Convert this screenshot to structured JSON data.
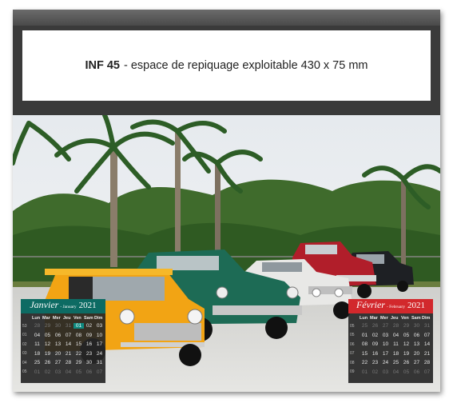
{
  "imprint": {
    "code": "INF 45",
    "text": "- espace de repiquage exploitable 430 x 75 mm"
  },
  "colors": {
    "january_header": "#0d6b63",
    "february_header": "#d2282c",
    "frame": "#3a3a3a"
  },
  "calendar": {
    "weekdays": [
      "Lun",
      "Mar",
      "Mer",
      "Jeu",
      "Ven",
      "Sam",
      "Dim"
    ],
    "january": {
      "name": "Janvier",
      "subtitle": "- January",
      "year": "2021",
      "weeks": [
        {
          "wk": "53",
          "days": [
            "28",
            "29",
            "30",
            "31",
            "01",
            "02",
            "03"
          ],
          "out": [
            true,
            true,
            true,
            true,
            false,
            false,
            false
          ]
        },
        {
          "wk": "01",
          "days": [
            "04",
            "05",
            "06",
            "07",
            "08",
            "09",
            "10"
          ],
          "out": [
            false,
            false,
            false,
            false,
            false,
            false,
            false
          ]
        },
        {
          "wk": "02",
          "days": [
            "11",
            "12",
            "13",
            "14",
            "15",
            "16",
            "17"
          ],
          "out": [
            false,
            false,
            false,
            false,
            false,
            false,
            false
          ]
        },
        {
          "wk": "03",
          "days": [
            "18",
            "19",
            "20",
            "21",
            "22",
            "23",
            "24"
          ],
          "out": [
            false,
            false,
            false,
            false,
            false,
            false,
            false
          ]
        },
        {
          "wk": "04",
          "days": [
            "25",
            "26",
            "27",
            "28",
            "29",
            "30",
            "31"
          ],
          "out": [
            false,
            false,
            false,
            false,
            false,
            false,
            false
          ]
        },
        {
          "wk": "05",
          "days": [
            "01",
            "02",
            "03",
            "04",
            "05",
            "06",
            "07"
          ],
          "out": [
            true,
            true,
            true,
            true,
            true,
            true,
            true
          ]
        }
      ],
      "highlight": "01"
    },
    "february": {
      "name": "Février",
      "subtitle": "- February",
      "year": "2021",
      "weeks": [
        {
          "wk": "05",
          "days": [
            "25",
            "26",
            "27",
            "28",
            "29",
            "30",
            "31"
          ],
          "out": [
            true,
            true,
            true,
            true,
            true,
            true,
            true
          ]
        },
        {
          "wk": "05",
          "days": [
            "01",
            "02",
            "03",
            "04",
            "05",
            "06",
            "07"
          ],
          "out": [
            false,
            false,
            false,
            false,
            false,
            false,
            false
          ]
        },
        {
          "wk": "06",
          "days": [
            "08",
            "09",
            "10",
            "11",
            "12",
            "13",
            "14"
          ],
          "out": [
            false,
            false,
            false,
            false,
            false,
            false,
            false
          ]
        },
        {
          "wk": "07",
          "days": [
            "15",
            "16",
            "17",
            "18",
            "19",
            "20",
            "21"
          ],
          "out": [
            false,
            false,
            false,
            false,
            false,
            false,
            false
          ]
        },
        {
          "wk": "08",
          "days": [
            "22",
            "23",
            "24",
            "25",
            "26",
            "27",
            "28"
          ],
          "out": [
            false,
            false,
            false,
            false,
            false,
            false,
            false
          ]
        },
        {
          "wk": "09",
          "days": [
            "01",
            "02",
            "03",
            "04",
            "05",
            "06",
            "07"
          ],
          "out": [
            true,
            true,
            true,
            true,
            true,
            true,
            true
          ]
        }
      ]
    }
  }
}
